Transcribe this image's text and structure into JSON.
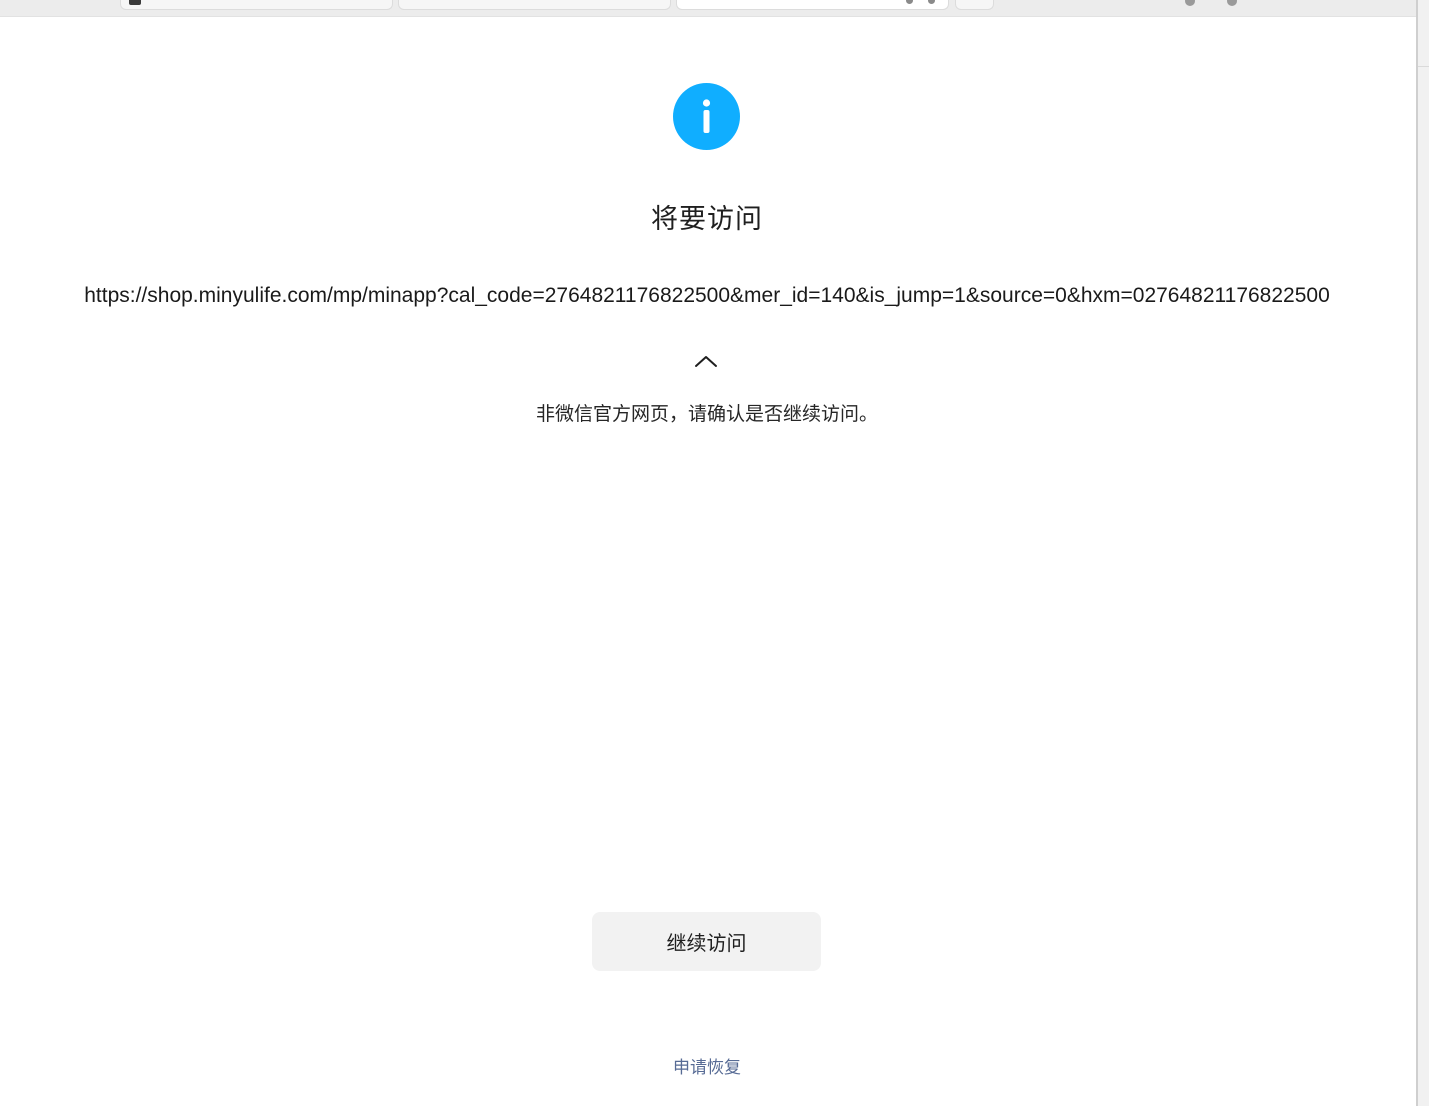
{
  "page": {
    "title": "将要访问",
    "url": "https://shop.minyulife.com/mp/minapp?cal_code=2764821176822500&mer_id=140&is_jump=1&source=0&hxm=02764821176822500",
    "notice": "非微信官方网页，请确认是否继续访问。",
    "continue_label": "继续访问",
    "appeal_label": "申请恢复"
  },
  "icons": {
    "header_icon": "info-icon",
    "toggle_icon": "chevron-up-icon"
  },
  "colors": {
    "info_icon": "#10aeff",
    "button_bg": "#f2f2f2",
    "link": "#576b95"
  }
}
